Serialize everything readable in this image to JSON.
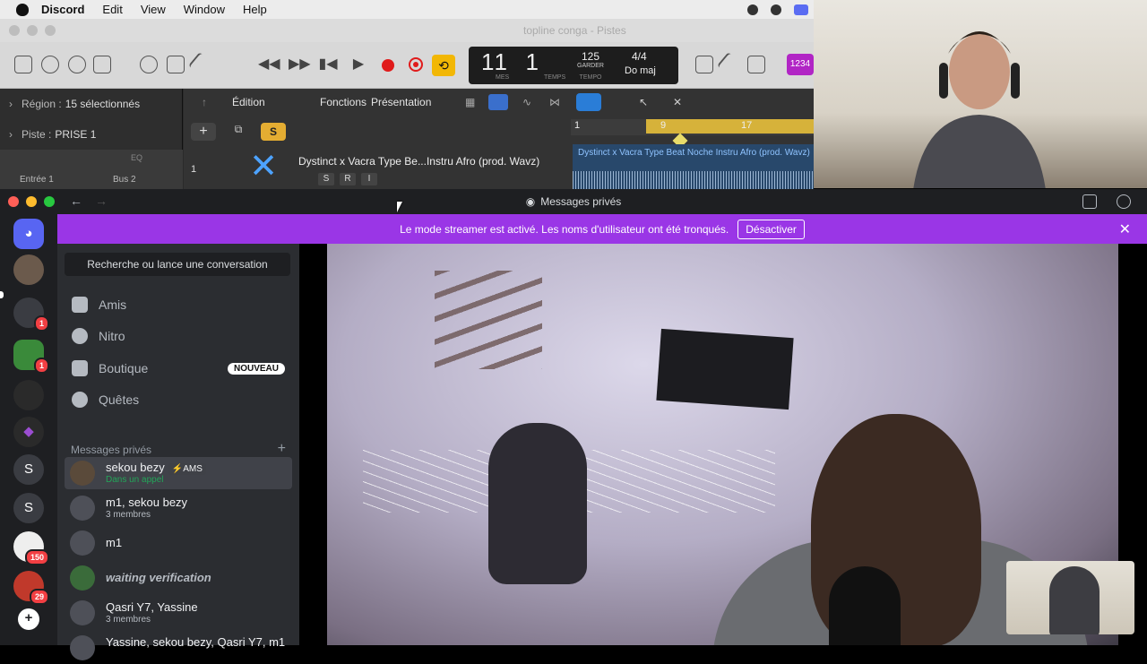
{
  "menubar": {
    "app": "Discord",
    "items": [
      "Edit",
      "View",
      "Window",
      "Help"
    ]
  },
  "logic": {
    "window_title": "topline conga - Pistes",
    "lcd": {
      "bars": "11",
      "beat": "1",
      "mes_label": "MES",
      "temps_label": "TEMPS",
      "bpm": "125",
      "keep_label": "GARDER",
      "tempo_label": "TEMPO",
      "time_sig": "4/4",
      "key": "Do maj"
    },
    "badge": "1234",
    "region_label": "Région :",
    "region_value": "15 sélectionnés",
    "track_label": "Piste :",
    "track_value": "PRISE 1",
    "input_label": "Entrée 1",
    "bus_label": "Bus 2",
    "eq_label": "EQ",
    "menus": [
      "Édition",
      "Fonctions",
      "Présentation"
    ],
    "s_button": "S",
    "track_number": "1",
    "track_name": "Dystinct x Vacra Type Be...Instru Afro (prod. Wavz)",
    "track_controls": [
      "S",
      "R",
      "I"
    ],
    "ruler": [
      "1",
      "9",
      "17"
    ],
    "region_name": "Dystinct x Vacra Type Beat Noche  Instru Afro (prod. Wavz)"
  },
  "discord": {
    "window_title": "Messages privés",
    "banner_text": "Le mode streamer est activé. Les noms d'utilisateur ont été tronqués.",
    "banner_button": "Désactiver",
    "search_placeholder": "Recherche ou lance une conversation",
    "nav": [
      {
        "label": "Amis"
      },
      {
        "label": "Nitro"
      },
      {
        "label": "Boutique",
        "badge": "NOUVEAU"
      },
      {
        "label": "Quêtes"
      }
    ],
    "dm_section_title": "Messages privés",
    "dm_add": "+",
    "conversations": [
      {
        "name": "sekou bezy",
        "tag": "⚡AMS",
        "sub": "Dans un appel"
      },
      {
        "name": "m1, sekou bezy",
        "sub": "3 membres"
      },
      {
        "name": "m1"
      },
      {
        "name": "waiting verification"
      },
      {
        "name": "Qasri Y7, Yassine",
        "sub": "3 membres"
      },
      {
        "name": "Yassine, sekou bezy, Qasri Y7, m1"
      }
    ],
    "guilds": [
      {
        "label": "",
        "badge": ""
      },
      {
        "label": "",
        "badge": "1"
      },
      {
        "label": "",
        "badge": "1"
      },
      {
        "label": "",
        "badge": ""
      },
      {
        "label": "",
        "badge": ""
      },
      {
        "label": "S",
        "badge": ""
      },
      {
        "label": "S",
        "badge": ""
      },
      {
        "label": "",
        "badge": "150"
      },
      {
        "label": "",
        "badge": "29"
      },
      {
        "label": "+",
        "badge": ""
      }
    ],
    "colors": {
      "brand": "#5865f2",
      "banner": "#9a36e6",
      "badge": "#f23f43"
    }
  }
}
